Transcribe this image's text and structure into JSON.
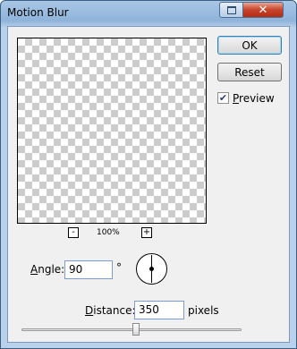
{
  "window": {
    "title": "Motion Blur"
  },
  "buttons": {
    "ok": "OK",
    "reset": "Reset"
  },
  "preview_option": {
    "label_first": "P",
    "label_rest": "review",
    "checked": true
  },
  "zoom": {
    "minus": "-",
    "plus": "+",
    "level": "100%"
  },
  "angle": {
    "label_first": "A",
    "label_rest": "ngle:",
    "value": "90",
    "unit": "°"
  },
  "distance": {
    "label_first": "D",
    "label_rest": "istance:",
    "value": "350",
    "unit": "pixels",
    "slider_fraction": 0.52
  }
}
